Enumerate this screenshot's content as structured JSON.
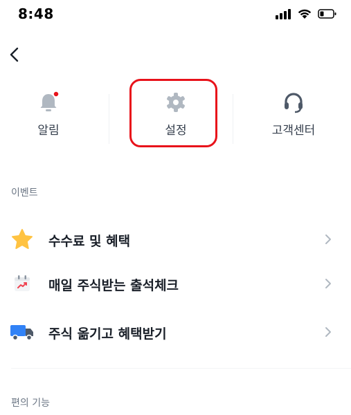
{
  "status_bar": {
    "time": "8:48"
  },
  "top_menu": {
    "items": [
      {
        "label": "알림",
        "icon": "bell-icon",
        "badge_color": "#e8121a"
      },
      {
        "label": "설정",
        "icon": "gear-icon"
      },
      {
        "label": "고객센터",
        "icon": "headset-icon"
      }
    ]
  },
  "sections": {
    "event": {
      "title": "이벤트",
      "items": [
        {
          "label": "수수료 및 혜택",
          "icon": "star-icon"
        },
        {
          "label": "매일 주식받는 출석체크",
          "icon": "calendar-chart-icon"
        },
        {
          "label": "주식 옮기고 혜택받기",
          "icon": "truck-icon"
        }
      ]
    },
    "convenience": {
      "title": "편의 기능"
    }
  },
  "colors": {
    "highlight": "#e8121a",
    "icon_gray": "#b0b8c1",
    "star": "#ffc342",
    "truck_blue": "#3182f6",
    "truck_gray": "#4e5968"
  }
}
